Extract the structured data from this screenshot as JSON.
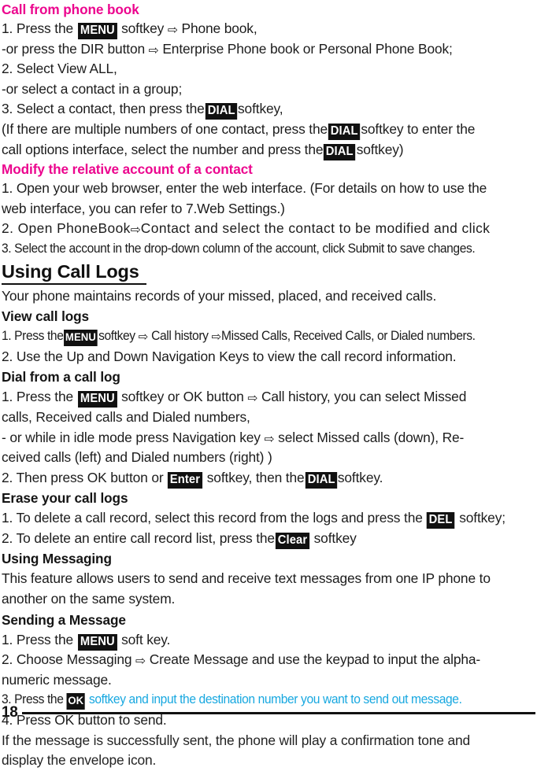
{
  "document": {
    "page_number": "18",
    "colors": {
      "heading_magenta": "#EC058E",
      "accent_cyan": "#18A8E0",
      "key_badge_bg": "#111111",
      "key_badge_text": "#FFFFFF",
      "body_text": "#1C1C1C"
    },
    "arrow_glyph": "⇨",
    "arrow_icon_name": "rightwards-white-arrow-icon"
  },
  "sections": [
    {
      "id": "call-from-phone-book",
      "heading": "Call from phone book",
      "heading_style": "magenta",
      "lines": [
        {
          "id": "cfpb-1",
          "runs": [
            {
              "t": "1. Press the "
            },
            {
              "k": "MENU"
            },
            {
              "t": " softkey "
            },
            {
              "a": true
            },
            {
              "t": " Phone book,"
            }
          ]
        },
        {
          "id": "cfpb-2",
          "runs": [
            {
              "t": "-or press the DIR button "
            },
            {
              "a": true
            },
            {
              "t": " Enterprise Phone book or Personal Phone Book;"
            }
          ]
        },
        {
          "id": "cfpb-3",
          "runs": [
            {
              "t": "2. Select View ALL,"
            }
          ]
        },
        {
          "id": "cfpb-4",
          "runs": [
            {
              "t": "-or select a contact in a group;"
            }
          ]
        },
        {
          "id": "cfpb-5",
          "runs": [
            {
              "t": "3. Select a contact, then press the"
            },
            {
              "k": "DIAL"
            },
            {
              "t": "softkey,"
            }
          ]
        },
        {
          "id": "cfpb-6",
          "runs": [
            {
              "t": "(If there are multiple numbers of one contact, press the"
            },
            {
              "k": "DIAL"
            },
            {
              "t": "softkey to enter the"
            }
          ]
        },
        {
          "id": "cfpb-7",
          "runs": [
            {
              "t": "call options interface, select the number and press the"
            },
            {
              "k": "DIAL"
            },
            {
              "t": "softkey)"
            }
          ]
        }
      ]
    },
    {
      "id": "modify-relative-account",
      "heading": "Modify the relative account of a contact",
      "heading_style": "magenta",
      "lines": [
        {
          "id": "mra-1",
          "runs": [
            {
              "t": "1. Open your web browser, enter the web interface. (For details on how to use the"
            }
          ]
        },
        {
          "id": "mra-2",
          "runs": [
            {
              "t": "web interface, you can refer to 7.Web Settings.)"
            }
          ]
        },
        {
          "id": "mra-3",
          "style": "wide",
          "runs": [
            {
              "t": "2. Open PhoneBook"
            },
            {
              "a": true
            },
            {
              "t": "Contact and select the contact to be modified and click"
            }
          ]
        },
        {
          "id": "mra-4",
          "style": "tight",
          "runs": [
            {
              "t": "3. Select the account in the drop-down column of the account, click Submit to save changes."
            }
          ]
        }
      ]
    },
    {
      "id": "using-call-logs",
      "heading": "Using Call Logs",
      "heading_style": "big-underline",
      "lines": [
        {
          "id": "ucl-1",
          "runs": [
            {
              "t": "Your phone maintains records of your missed, placed, and received calls."
            }
          ]
        }
      ],
      "subsections": [
        {
          "id": "view-call-logs",
          "heading": "View call logs",
          "lines": [
            {
              "id": "vcl-1",
              "style": "tight",
              "runs": [
                {
                  "t": "1. Press the"
                },
                {
                  "k": "MENU",
                  "tight": true
                },
                {
                  "t": "softkey "
                },
                {
                  "a": true
                },
                {
                  "t": " Call history "
                },
                {
                  "a": true
                },
                {
                  "t": "Missed Calls, Received Calls, or Dialed numbers."
                }
              ]
            },
            {
              "id": "vcl-2",
              "runs": [
                {
                  "t": "2. Use the Up and Down Navigation Keys to view the call record information."
                }
              ]
            }
          ]
        },
        {
          "id": "dial-from-call-log",
          "heading": "Dial from a call log",
          "lines": [
            {
              "id": "dfcl-1",
              "runs": [
                {
                  "t": "1.  Press the "
                },
                {
                  "k": "MENU"
                },
                {
                  "t": " softkey or OK button "
                },
                {
                  "a": true
                },
                {
                  "t": " Call history, you can select Missed"
                }
              ]
            },
            {
              "id": "dfcl-2",
              "runs": [
                {
                  "t": "calls, Received calls and Dialed numbers,"
                }
              ]
            },
            {
              "id": "dfcl-3",
              "runs": [
                {
                  "t": " - or while in idle mode press Navigation key "
                },
                {
                  "a": true
                },
                {
                  "t": " select Missed calls (down), Re-"
                }
              ]
            },
            {
              "id": "dfcl-4",
              "runs": [
                {
                  "t": "ceived calls (left) and Dialed numbers (right) )"
                }
              ]
            },
            {
              "id": "dfcl-5",
              "runs": [
                {
                  "t": "2. Then press OK button or "
                },
                {
                  "k": "Enter"
                },
                {
                  "t": " softkey, then the"
                },
                {
                  "k": "DIAL"
                },
                {
                  "t": "softkey."
                }
              ]
            }
          ]
        },
        {
          "id": "erase-your-call-logs",
          "heading": "Erase your call logs",
          "lines": [
            {
              "id": "eycl-1",
              "runs": [
                {
                  "t": "1. To delete a call record, select this record from the logs and press the "
                },
                {
                  "k": "DEL"
                },
                {
                  "t": " softkey;"
                }
              ]
            },
            {
              "id": "eycl-2",
              "runs": [
                {
                  "t": "2. To delete an entire call record list, press the"
                },
                {
                  "k": "Clear"
                },
                {
                  "t": " softkey"
                }
              ]
            }
          ]
        },
        {
          "id": "using-messaging",
          "heading": "Using Messaging",
          "lines": [
            {
              "id": "um-1",
              "runs": [
                {
                  "t": "This feature allows users to send and receive text messages from one IP phone to"
                }
              ]
            },
            {
              "id": "um-2",
              "runs": [
                {
                  "t": "another on the same system."
                }
              ]
            }
          ]
        },
        {
          "id": "sending-a-message",
          "heading": " Sending a Message",
          "lines": [
            {
              "id": "sam-1",
              "runs": [
                {
                  "t": "1. Press the "
                },
                {
                  "k": "MENU"
                },
                {
                  "t": " soft key."
                }
              ]
            },
            {
              "id": "sam-2",
              "runs": [
                {
                  "t": "2. Choose Messaging "
                },
                {
                  "a": true
                },
                {
                  "t": " Create Message and use the keypad to input the alpha-"
                }
              ]
            },
            {
              "id": "sam-3",
              "runs": [
                {
                  "t": "numeric message."
                }
              ]
            },
            {
              "id": "sam-4",
              "style": "tight",
              "runs": [
                {
                  "t": "3. Press the "
                },
                {
                  "k": "OK",
                  "tight": true
                },
                {
                  "t": " softkey and input the destination number you want to send out message.",
                  "c": "cyan"
                }
              ]
            },
            {
              "id": "sam-5",
              "runs": [
                {
                  "t": "4. Press OK button to send."
                }
              ]
            },
            {
              "id": "sam-6",
              "style": "lighter",
              "runs": [
                {
                  "t": "If the message is successfully sent, the phone will play a confirmation tone and"
                }
              ]
            },
            {
              "id": "sam-7",
              "style": "lighter",
              "runs": [
                {
                  "t": "display the envelope icon."
                }
              ]
            }
          ]
        }
      ]
    }
  ]
}
